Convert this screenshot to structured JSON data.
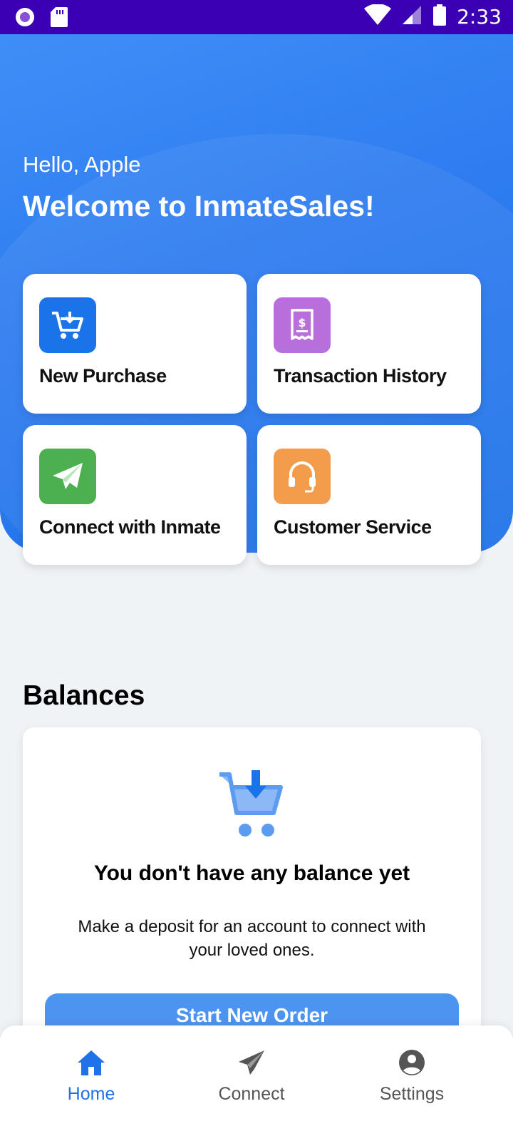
{
  "status_bar": {
    "time": "2:33",
    "icons": [
      "record-icon",
      "sd-card-icon",
      "wifi-icon",
      "signal-icon",
      "battery-icon"
    ]
  },
  "header": {
    "greeting": "Hello, Apple",
    "welcome": "Welcome to InmateSales!"
  },
  "tiles": [
    {
      "label": "New Purchase",
      "icon": "cart-download-icon",
      "color": "#1a73e8"
    },
    {
      "label": "Transaction History",
      "icon": "receipt-icon",
      "color": "#b86fdc"
    },
    {
      "label": "Connect with Inmate",
      "icon": "paper-plane-icon",
      "color": "#4caf50"
    },
    {
      "label": "Customer Service",
      "icon": "headset-icon",
      "color": "#f39c4b"
    }
  ],
  "balances": {
    "title": "Balances",
    "empty_title": "You don't have any balance yet",
    "empty_desc": "Make a deposit for an account to connect with your loved ones.",
    "button": "Start New Order"
  },
  "bottom_nav": {
    "items": [
      {
        "label": "Home",
        "icon": "home-icon",
        "active": true
      },
      {
        "label": "Connect",
        "icon": "send-icon",
        "active": false
      },
      {
        "label": "Settings",
        "icon": "account-circle-icon",
        "active": false
      }
    ]
  },
  "colors": {
    "primary": "#1f72e8",
    "status_bar": "#3b00b4",
    "background": "#f0f3f6"
  }
}
